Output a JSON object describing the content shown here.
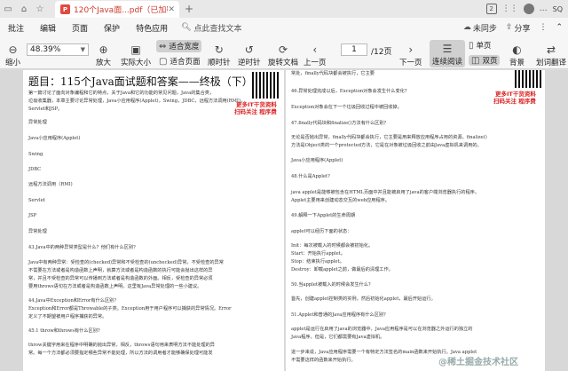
{
  "titlebar": {
    "doc_tab_title": "120个Java面...pdf（已加密）",
    "pdf_badge": "P",
    "tab_count": "2",
    "user": "SQ"
  },
  "menubar": {
    "items": [
      "批注",
      "编辑",
      "页面",
      "保护",
      "特色应用"
    ],
    "search_label": "点此查找文本",
    "unsync_label": "未同步",
    "share_label": "分享"
  },
  "toolbar": {
    "zoom_value": "48.39%",
    "zoom_out_label": "缩小",
    "zoom_in_label": "放大",
    "actual_size_label": "实际大小",
    "fit_width_label": "适合宽度",
    "fit_page_label": "适合页面",
    "rotate_cw_label": "顺时针",
    "rotate_ccw_label": "逆时针",
    "rotate_doc_label": "旋转文档",
    "prev_page_label": "上一页",
    "next_page_label": "下一页",
    "page_value": "1",
    "page_total": "/12页",
    "continuous_label": "连续阅读",
    "single_label": "单页",
    "double_label": "双页",
    "background_label": "背景",
    "translate_label": "划词翻译"
  },
  "left_page": {
    "title": "题目：115个Java面试题和答案——终极（下）",
    "promo": [
      "更多IT干货资料",
      "扫码关注 程序费 "
    ],
    "lines": [
      "第一篇讨论了面向对象编程和它的特点，关于Java和它的功能的常见问题，Java的集合类，",
      "垃圾收集器，本章主要讨论异常处理，Java小应用程序(Applet)，Swing，JDBC，远程方法调用(RMI)，",
      "Servlet和JSP。",
      "异常处理",
      "Java小应用程序(Applet)",
      "Swing",
      "JDBC",
      "远程方法调用（RMI)",
      "Servlet",
      "JSP",
      "异常处理",
      "43.Java中的两种异常类型是什么？他们有什么区别?",
      "Java中有两种异常：受检查的(checked)异常和不受检查的(unchecked)异常。不受检查的异常",
      "不需要在方法或者是构造函数上声明，就算方法或者是构造函数的执行可能会抛出这样的异",
      "常，并且不受检查的异常可以传播到方法或者是构造函数的外面。相反，受检查的异常必须",
      "要用throws语句在方法或者是构造函数上声明。这里有Java异常处理的一些小建议。",
      "44.Java中Exception和Error有什么区别？",
      "Exception和Error都是Throwable的子类。Exception用于用户程序可以捕获的异常情况。Error",
      "定义了不期望被用户程序捕获的异常。",
      "45.1 throw和throws有什么区别?",
      "throw关键字用来在程序中明确的抛出异常，相反，throws语句用来表明方法不能处理的异",
      "常。每一个方法都必须要指定哪些异常不能处理，所以方法的调用者才能够确保处理可能发"
    ]
  },
  "right_page": {
    "promo": [
      "更多IT干货资料",
      "扫码关注 程序费 "
    ],
    "lines": [
      "常处，finally代码块都会被执行，它主要",
      "46.异常处理完成以后，Exception对象会发生什么变化？",
      "Exception对象会在下一个垃圾回收过程中被回收掉。",
      "47.finally代码块和finalize()方法有什么区别？",
      "无论是否抛出异常，finally代码块都会执行，它主要是用来释放应用程序占用的资源。finalize()",
      "方法是Object类的一个protected方法，它是在对象被垃圾回收之前由Java虚拟机来调用的。",
      "Java小应用程序(Applet)",
      "48.什么是Applet?",
      "java applet是能够被包含在HTML页面中并且能被启用了java的客户端浏览器执行的程序。",
      "Applet主要用来创建动态交互的web应用程序。",
      "49.解释一下Applet的生命周期",
      "applet可以经历下面的状态：",
      "Init：每次被载入的时候都会被初始化。",
      "Start：开始执行applet。",
      "Stop：结束执行applet。",
      "Destroy：卸载applet之前，做最后的清理工作。",
      "50.当applet被载入的时候会发生什么？",
      "首先，创建applet控制类的实例，然后初始化applet，最后开始运行。",
      "51.Applet和普通的Java应用程序有什么区别？",
      "applet是运行在启用了java的浏览器中，Java应用程序是可以在浏览器之外运行的独立的",
      "Java程序。但是，它们都需要有Java虚拟机。",
      "进一步来说，Java应用程序需要一个有特定方法签名的main函数来开始执行。Java applet",
      "不需要这样的函数来开始执行。"
    ],
    "watermark": "@稀土掘金技术社区"
  }
}
